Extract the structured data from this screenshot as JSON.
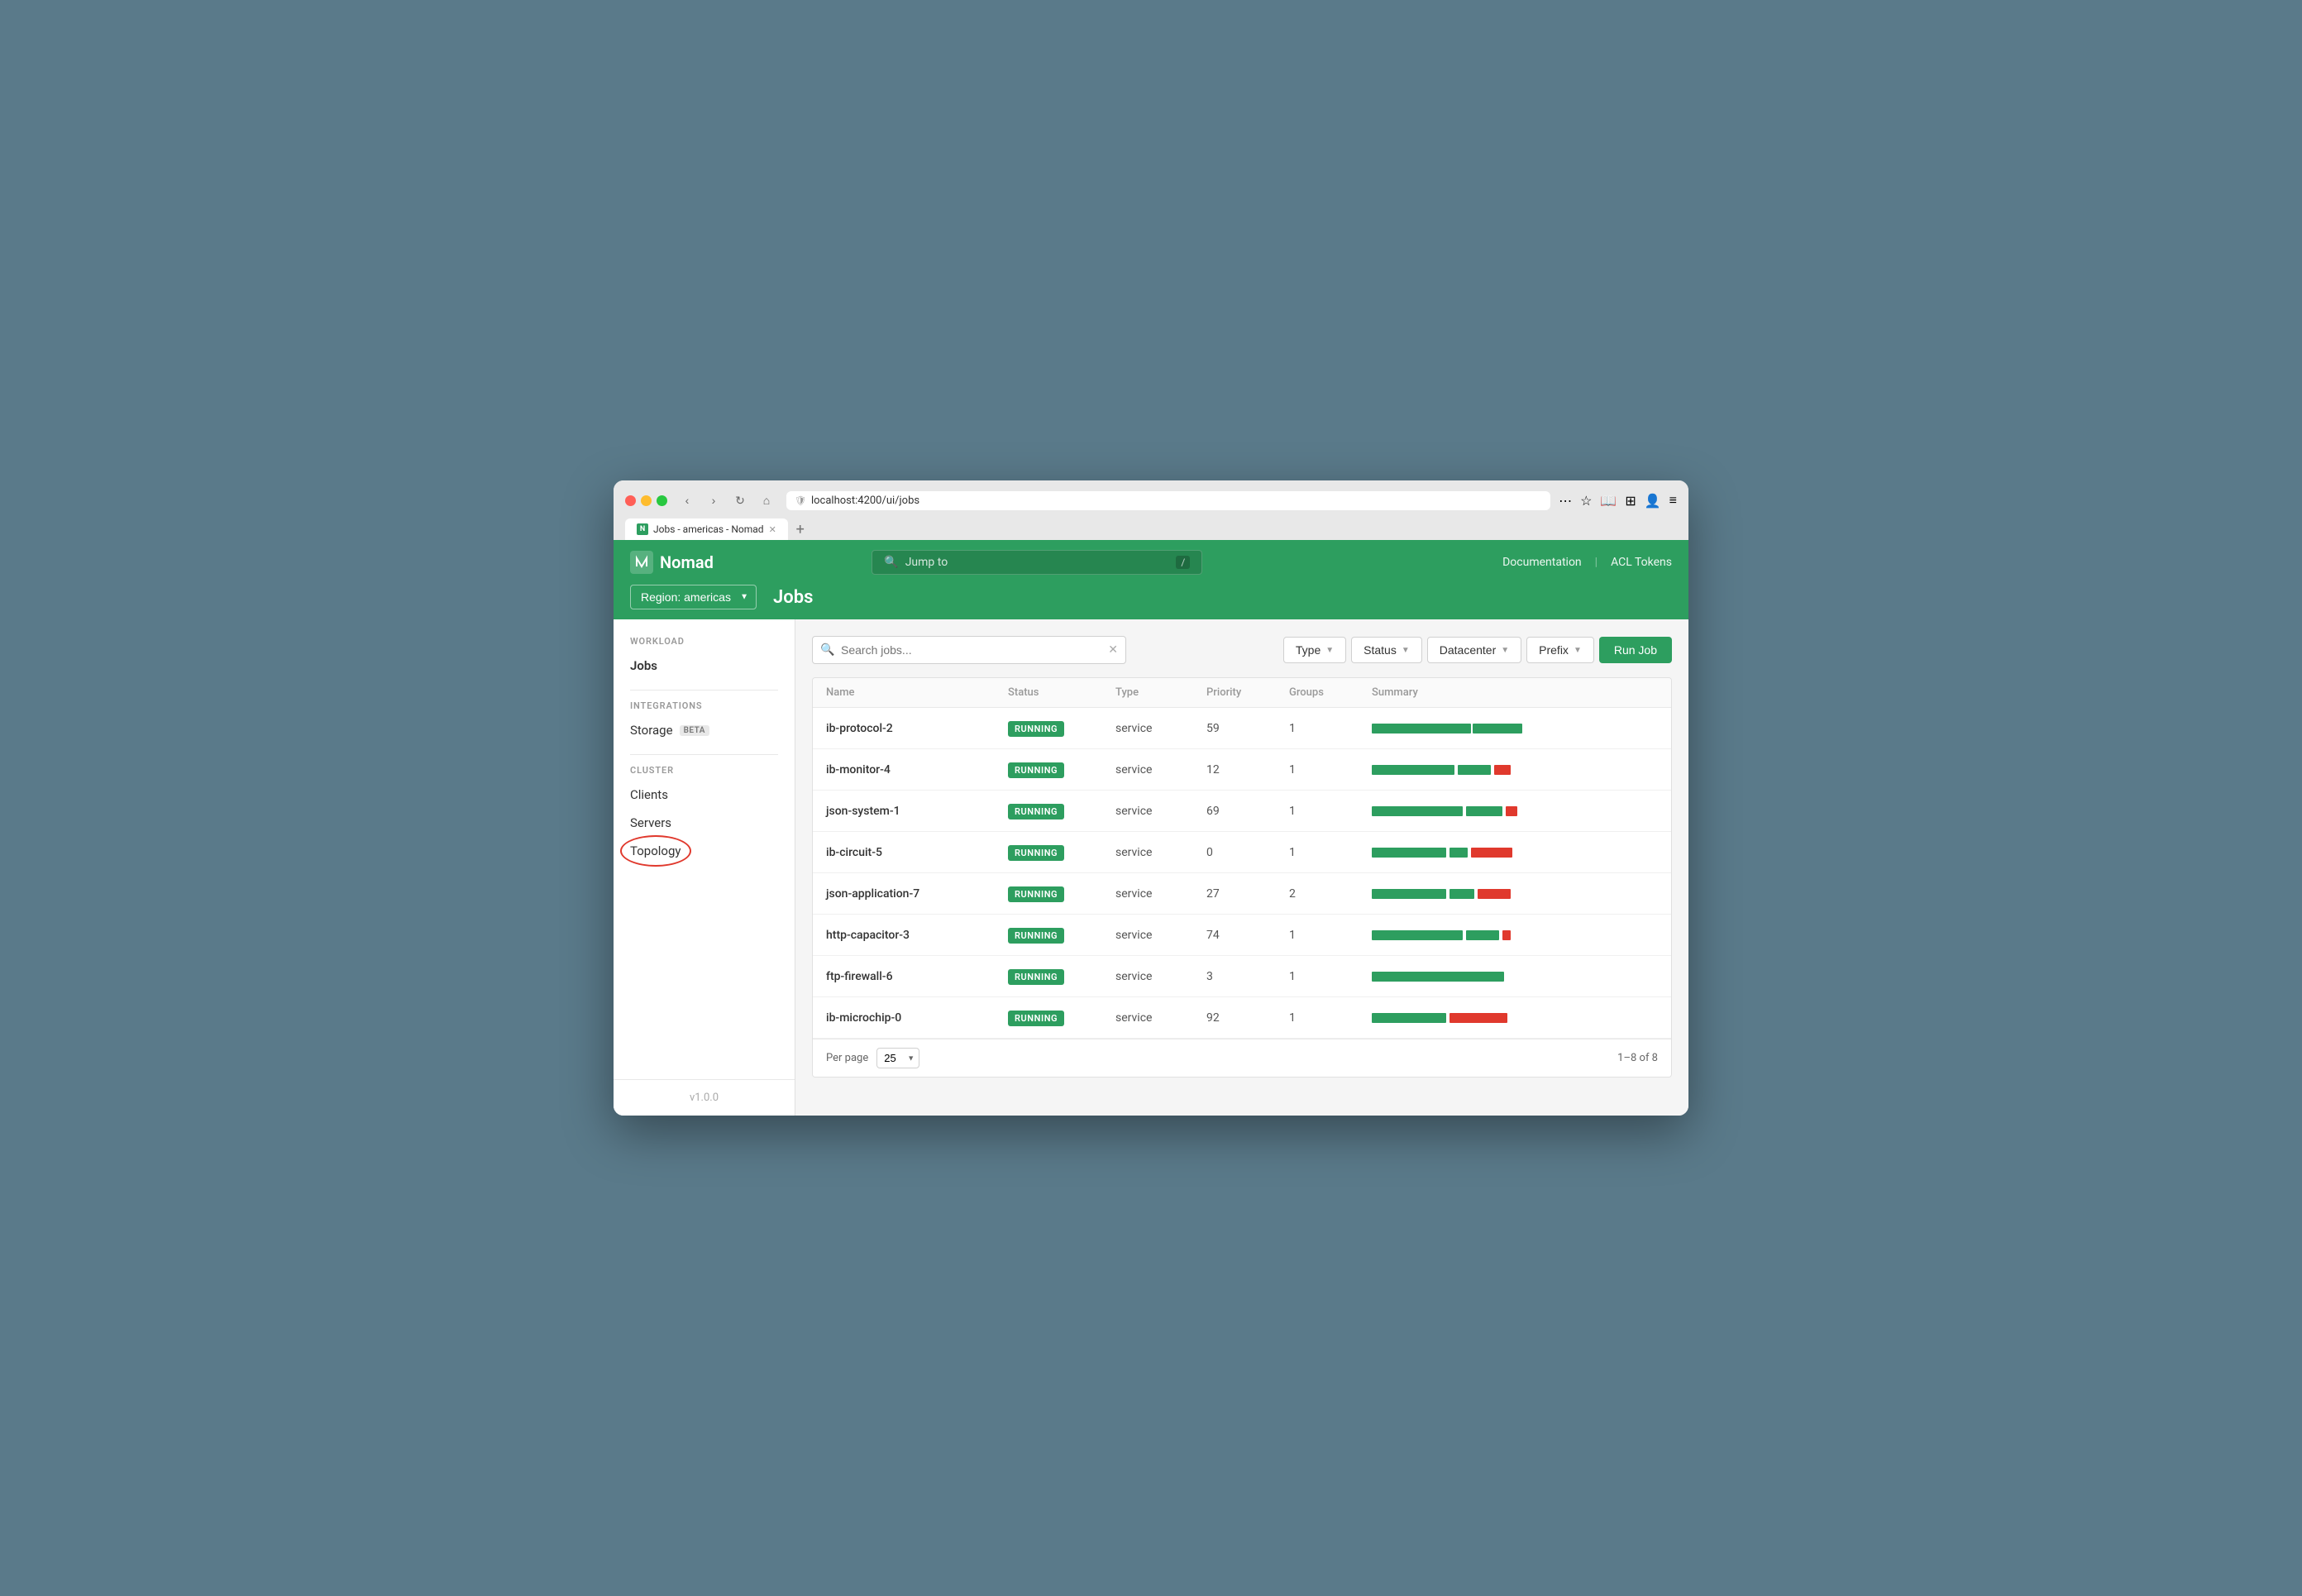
{
  "browser": {
    "url": "localhost:4200/ui/jobs",
    "tab_title": "Jobs - americas - Nomad",
    "tab_new_label": "+"
  },
  "header": {
    "logo_text": "Nomad",
    "logo_abbr": "N",
    "search_placeholder": "Jump to",
    "search_shortcut": "/",
    "doc_link": "Documentation",
    "acl_link": "ACL Tokens",
    "divider": "|"
  },
  "subheader": {
    "region_label": "Region: americas",
    "page_title": "Jobs"
  },
  "sidebar": {
    "workload_label": "WORKLOAD",
    "jobs_label": "Jobs",
    "integrations_label": "INTEGRATIONS",
    "storage_label": "Storage",
    "storage_badge": "BETA",
    "cluster_label": "CLUSTER",
    "clients_label": "Clients",
    "servers_label": "Servers",
    "topology_label": "Topology",
    "version": "v1.0.0"
  },
  "toolbar": {
    "search_placeholder": "Search jobs...",
    "type_label": "Type",
    "status_label": "Status",
    "datacenter_label": "Datacenter",
    "prefix_label": "Prefix",
    "run_job_label": "Run Job"
  },
  "table": {
    "headers": [
      "Name",
      "Status",
      "Type",
      "Priority",
      "Groups",
      "Summary"
    ],
    "rows": [
      {
        "name": "ib-protocol-2",
        "status": "RUNNING",
        "type": "service",
        "priority": "59",
        "groups": "1",
        "bar": [
          {
            "color": "green",
            "width": 120
          },
          {
            "color": "green",
            "width": 60
          }
        ]
      },
      {
        "name": "ib-monitor-4",
        "status": "RUNNING",
        "type": "service",
        "priority": "12",
        "groups": "1",
        "bar": [
          {
            "color": "green",
            "width": 100
          },
          {
            "color": "green",
            "width": 40
          },
          {
            "color": "red",
            "width": 20
          }
        ]
      },
      {
        "name": "json-system-1",
        "status": "RUNNING",
        "type": "service",
        "priority": "69",
        "groups": "1",
        "bar": [
          {
            "color": "green",
            "width": 110
          },
          {
            "color": "green",
            "width": 40
          },
          {
            "color": "red",
            "width": 14
          }
        ]
      },
      {
        "name": "ib-circuit-5",
        "status": "RUNNING",
        "type": "service",
        "priority": "0",
        "groups": "1",
        "bar": [
          {
            "color": "green",
            "width": 90
          },
          {
            "color": "green",
            "width": 20
          },
          {
            "color": "red",
            "width": 50
          }
        ]
      },
      {
        "name": "json-application-7",
        "status": "RUNNING",
        "type": "service",
        "priority": "27",
        "groups": "2",
        "bar": [
          {
            "color": "green",
            "width": 90
          },
          {
            "color": "green",
            "width": 30
          },
          {
            "color": "red",
            "width": 40
          }
        ]
      },
      {
        "name": "http-capacitor-3",
        "status": "RUNNING",
        "type": "service",
        "priority": "74",
        "groups": "1",
        "bar": [
          {
            "color": "green",
            "width": 110
          },
          {
            "color": "green",
            "width": 40
          },
          {
            "color": "red",
            "width": 10
          }
        ]
      },
      {
        "name": "ftp-firewall-6",
        "status": "RUNNING",
        "type": "service",
        "priority": "3",
        "groups": "1",
        "bar": [
          {
            "color": "green",
            "width": 160
          }
        ]
      },
      {
        "name": "ib-microchip-0",
        "status": "RUNNING",
        "type": "service",
        "priority": "92",
        "groups": "1",
        "bar": [
          {
            "color": "green",
            "width": 90
          },
          {
            "color": "red",
            "width": 70
          }
        ]
      }
    ],
    "per_page_label": "Per page",
    "per_page_value": "25",
    "pagination": "1–8 of 8"
  }
}
